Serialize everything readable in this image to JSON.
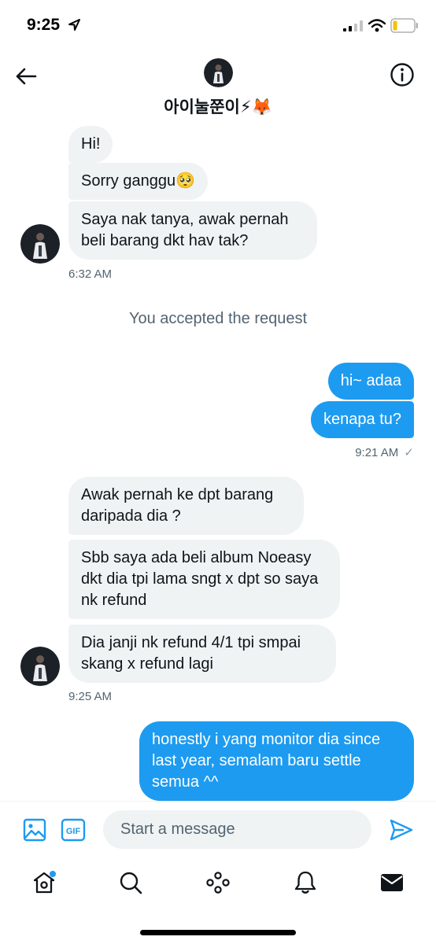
{
  "status_bar": {
    "time": "9:25"
  },
  "header": {
    "name": "아이눌쭌이⚡🦊"
  },
  "messages": [
    {
      "type": "in",
      "text": "Hi!"
    },
    {
      "type": "in",
      "text": "Sorry ganggu🥺"
    },
    {
      "type": "in",
      "text": "Saya nak tanya, awak pernah beli barang dkt hav tak?"
    },
    {
      "type": "timestamp",
      "text": "6:32 AM"
    },
    {
      "type": "system",
      "text": "You accepted the request"
    },
    {
      "type": "out",
      "text": "hi~ adaa"
    },
    {
      "type": "out",
      "text": "kenapa tu?"
    },
    {
      "type": "timestamp",
      "text": "9:21 AM",
      "status": "✓"
    },
    {
      "type": "in",
      "text": "Awak pernah ke dpt barang daripada dia ?"
    },
    {
      "type": "in",
      "text": "Sbb saya ada beli album Noeasy dkt dia tpi lama sngt x dpt so saya nk refund"
    },
    {
      "type": "in",
      "text": "Dia janji nk refund 4/1 tpi smpai skang x refund lagi"
    },
    {
      "type": "timestamp",
      "text": "9:25 AM"
    },
    {
      "type": "out",
      "text": "honestly i yang monitor dia since last year, semalam baru settle semua ^^"
    }
  ],
  "composer": {
    "placeholder": "Start a message",
    "gif_label": "GIF"
  },
  "tabs": [
    {
      "name": "home",
      "has_badge": true
    },
    {
      "name": "search"
    },
    {
      "name": "spaces"
    },
    {
      "name": "notifications"
    },
    {
      "name": "messages",
      "active": true
    }
  ],
  "colors": {
    "accent": "#1d9bf0",
    "bubble_in": "#eff3f4",
    "secondary_text": "#536471"
  }
}
